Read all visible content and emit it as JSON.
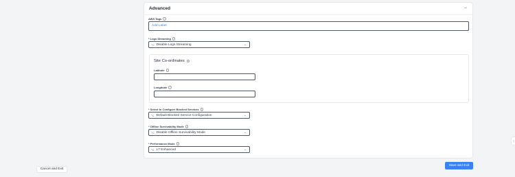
{
  "section": {
    "title": "Advanced",
    "collapse_glyph": "–"
  },
  "aws_tags": {
    "label": "AWS Tags",
    "add_label": "Add Label"
  },
  "logs_streaming": {
    "label": "* Logs Streaming",
    "value": "Disable Logs Streaming"
  },
  "site_coordinates": {
    "title": "Site Co-ordinates",
    "latitude_label": "Latitude",
    "longitude_label": "Longitude",
    "latitude_value": "",
    "longitude_value": ""
  },
  "blocked_services": {
    "label": "* Select to Configure Blocked Services",
    "value": "Default Blocked Service Configuration"
  },
  "offline_survivability": {
    "label": "* Offline Survivability Mode",
    "value": "Disable Offline Survivability Mode"
  },
  "performance_mode": {
    "label": "* Performance Mode",
    "value": "L7 Enhanced"
  },
  "footer": {
    "cancel_label": "Cancel and Exit",
    "save_label": "Save and Exit"
  },
  "icons": {
    "info": "i",
    "select": "⌥",
    "chevron": "⌄",
    "side_tab": "⟨"
  },
  "colors": {
    "accent": "#3b82f6",
    "background": "#f3f4f6"
  }
}
